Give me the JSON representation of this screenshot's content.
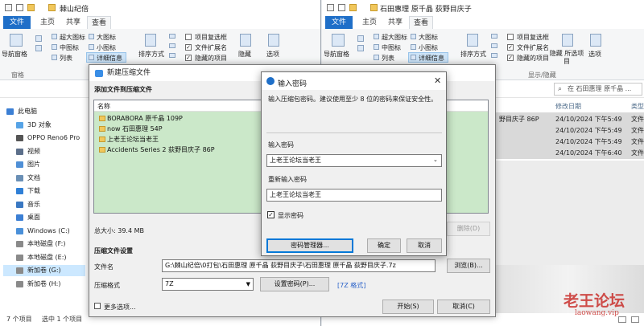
{
  "left_window": {
    "title": "棘山纪倍",
    "tabs": {
      "file": "文件",
      "home": "主页",
      "share": "共享",
      "view": "查看"
    },
    "ribbon": {
      "nav_pane": "导航窗格",
      "pane": "窗格",
      "large_icons": "超大图标",
      "big_icons": "大图标",
      "medium_icons": "中图标",
      "small_icons": "小图标",
      "list": "列表",
      "details": "详细信息",
      "sort_by": "排序方式",
      "item_checkbox": "项目复选框",
      "file_ext": "文件扩展名",
      "hidden_items": "隐藏的项目",
      "hide": "隐藏",
      "options": "选项"
    },
    "nav": [
      {
        "label": "此电脑",
        "color": "#3b7fd4"
      },
      {
        "label": "3D 对象",
        "color": "#56a3e6"
      },
      {
        "label": "OPPO Reno6 Pro",
        "color": "#555555"
      },
      {
        "label": "视频",
        "color": "#5c6f8a"
      },
      {
        "label": "图片",
        "color": "#4f8fd6"
      },
      {
        "label": "文档",
        "color": "#6a8fb5"
      },
      {
        "label": "下载",
        "color": "#2f7fd6"
      },
      {
        "label": "音乐",
        "color": "#3a78c2"
      },
      {
        "label": "桌面",
        "color": "#3b7fd4"
      },
      {
        "label": "Windows (C:)",
        "color": "#4a90d9"
      },
      {
        "label": "本地磁盘 (F:)",
        "color": "#8a8a8a"
      },
      {
        "label": "本地磁盘 (E:)",
        "color": "#8a8a8a"
      },
      {
        "label": "新加卷 (G:)",
        "color": "#8a8a8a"
      },
      {
        "label": "新加卷 (H:)",
        "color": "#8a8a8a"
      }
    ],
    "status": {
      "count": "7 个项目",
      "selected": "选中 1 个项目"
    }
  },
  "right_window": {
    "title": "石田惠理 原千晶 荻野目庆子",
    "search_placeholder": "在 石田惠理 原千晶 ...",
    "columns": {
      "modified": "修改日期",
      "type": "类型"
    },
    "ribbon": {
      "pane": "窗格",
      "show_hide": "显示/隐藏",
      "hide_selected": "隐藏 所选项目"
    },
    "rows": [
      {
        "name": "野目庆子 86P",
        "date": "24/10/2024 下午5:49",
        "type": "文件"
      },
      {
        "name": "",
        "date": "24/10/2024 下午5:49",
        "type": "文件"
      },
      {
        "name": "",
        "date": "24/10/2024 下午5:49",
        "type": "文件"
      },
      {
        "name": "",
        "date": "24/10/2024 下午6:40",
        "type": "文件"
      }
    ]
  },
  "archive_dialog": {
    "title": "新建压缩文件",
    "section_add": "添加文件到压缩文件",
    "col_name": "名称",
    "files": [
      "BORABORA 原千晶 109P",
      "now 石田惠理 54P",
      "上老王论坛当老王",
      "Accidents Series 2 荻野目庆子 86P"
    ],
    "total_size": "总大小: 39.4 MB",
    "delete_btn": "删除(D)",
    "section_settings": "压缩文件设置",
    "filename_label": "文件名",
    "filename_value": "G:\\棘山纪倍\\0打包\\石田惠理 原千晶 荻野目庆子\\石田惠理 原千晶 荻野目庆子.7z",
    "browse_btn": "浏览(B)...",
    "format_label": "压缩格式",
    "format_value": "7Z",
    "set_password_btn": "设置密码(P)...",
    "format_link": "[7Z 格式]",
    "more_options": "更多选项...",
    "start_btn": "开始(S)",
    "cancel_btn": "取消(C)"
  },
  "password_dialog": {
    "title": "输入密码",
    "hint": "输入压缩包密码。建议使用至少 8 位的密码来保证安全性。",
    "password_label": "输入密码",
    "password_value": "上老王论坛当老王",
    "confirm_label": "重新输入密码",
    "confirm_value": "上老王论坛当老王",
    "show_password": "显示密码",
    "show_password_checked": true,
    "manager_btn": "密码管理器...",
    "ok_btn": "确定",
    "cancel_btn": "取消"
  },
  "watermark": {
    "cn": "老王论坛",
    "url": "laowang.vip"
  }
}
